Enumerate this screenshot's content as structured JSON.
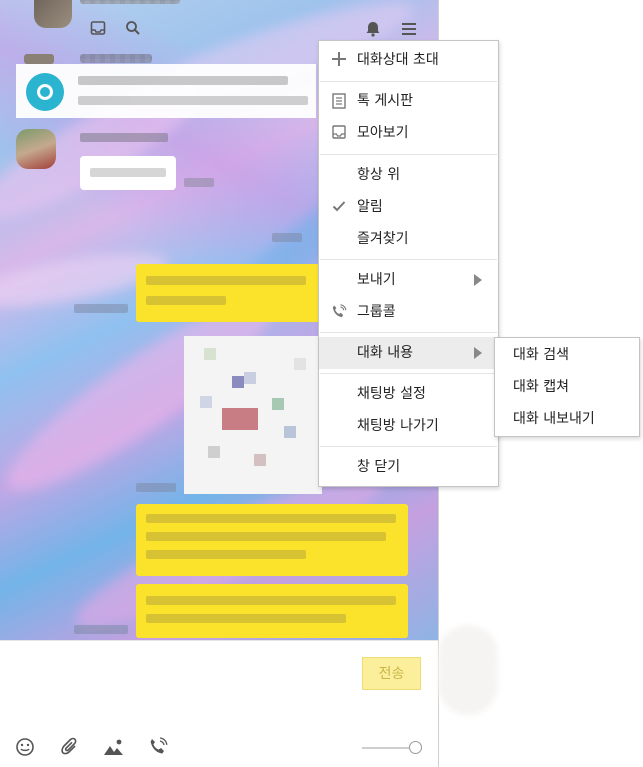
{
  "chat": {
    "send_label": "전송"
  },
  "menu": {
    "items": [
      {
        "label": "대화상대 초대",
        "icon": "plus-icon"
      },
      {
        "label": "톡 게시판",
        "icon": "document-icon"
      },
      {
        "label": "모아보기",
        "icon": "inbox-icon"
      },
      {
        "label": "항상 위"
      },
      {
        "label": "알림",
        "checked": true,
        "icon": "check-icon"
      },
      {
        "label": "즐겨찾기"
      },
      {
        "label": "보내기",
        "has_submenu": true
      },
      {
        "label": "그룹콜",
        "icon": "phone-icon"
      },
      {
        "label": "대화 내용",
        "has_submenu": true,
        "highlighted": true
      },
      {
        "label": "채팅방 설정"
      },
      {
        "label": "채팅방 나가기"
      },
      {
        "label": "창 닫기"
      }
    ]
  },
  "submenu": {
    "items": [
      {
        "label": "대화 검색"
      },
      {
        "label": "대화 캡쳐"
      },
      {
        "label": "대화 내보내기"
      }
    ]
  },
  "colors": {
    "yellow_bubble": "#fbe32c",
    "menu_highlight": "#ececec",
    "send_button": "#fcef9c"
  }
}
